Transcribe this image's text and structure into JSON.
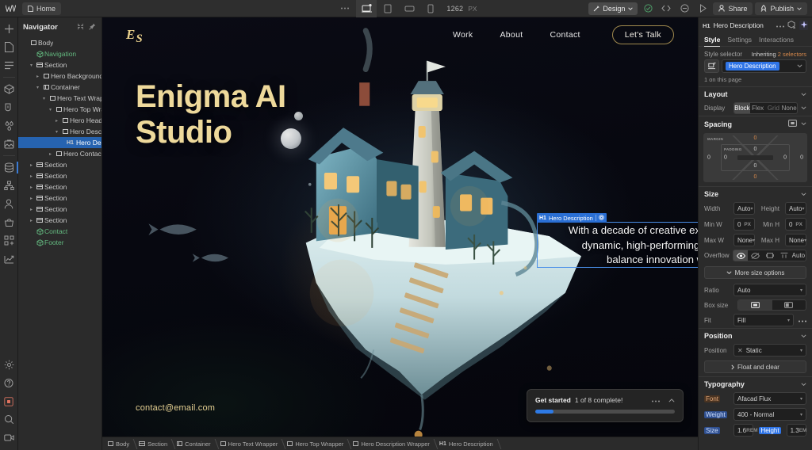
{
  "topbar": {
    "logo": "W",
    "page_label": "Home",
    "breakpoints": [
      "desktop",
      "tablet",
      "mobile-landscape",
      "mobile-portrait"
    ],
    "canvas_width": "1262",
    "canvas_unit": "PX",
    "mode_label": "Design",
    "share_label": "Share",
    "publish_label": "Publish",
    "icons": [
      "more-horizontal-icon",
      "checkmark-circle-icon",
      "code-icon",
      "preview-icon",
      "play-icon",
      "person-icon",
      "rocket-icon"
    ]
  },
  "rail": {
    "items": [
      {
        "name": "add-element",
        "icon": "plus-icon"
      },
      {
        "name": "pages",
        "icon": "page-icon"
      },
      {
        "name": "navigator",
        "icon": "layers-icon"
      },
      {
        "name": "components",
        "icon": "cube-icon"
      },
      {
        "name": "style-manager",
        "icon": "paint-icon"
      },
      {
        "name": "variables",
        "icon": "droplets-icon"
      },
      {
        "name": "assets",
        "icon": "image-icon"
      },
      {
        "name": "cms",
        "icon": "database-icon"
      },
      {
        "name": "logic",
        "icon": "flow-icon"
      },
      {
        "name": "users",
        "icon": "user-icon"
      },
      {
        "name": "ecommerce",
        "icon": "basket-icon"
      },
      {
        "name": "apps",
        "icon": "apps-icon"
      },
      {
        "name": "analyze",
        "icon": "chart-icon"
      }
    ],
    "bottom": [
      {
        "name": "settings",
        "icon": "gear-icon"
      },
      {
        "name": "help",
        "icon": "question-icon"
      },
      {
        "name": "recording",
        "icon": "record-icon"
      },
      {
        "name": "search",
        "icon": "search-icon"
      },
      {
        "name": "video",
        "icon": "video-icon"
      }
    ]
  },
  "navigator": {
    "title": "Navigator",
    "header_icons": [
      "collapse-all-icon",
      "pin-icon"
    ],
    "tree": [
      {
        "label": "Body",
        "indent": 0,
        "twisty": "",
        "icon": "square",
        "kind": "el"
      },
      {
        "label": "Navigation",
        "indent": 1,
        "twisty": "",
        "icon": "component",
        "kind": "component"
      },
      {
        "label": "Section",
        "indent": 1,
        "twisty": "v",
        "icon": "section",
        "kind": "el"
      },
      {
        "label": "Hero Background Wrap",
        "indent": 2,
        "twisty": ">",
        "icon": "square",
        "kind": "el"
      },
      {
        "label": "Container",
        "indent": 2,
        "twisty": "v",
        "icon": "container",
        "kind": "el"
      },
      {
        "label": "Hero Text Wrapper",
        "indent": 3,
        "twisty": "v",
        "icon": "square",
        "kind": "el"
      },
      {
        "label": "Hero Top Wrapper",
        "indent": 4,
        "twisty": "v",
        "icon": "square",
        "kind": "el"
      },
      {
        "label": "Hero Heading W",
        "indent": 5,
        "twisty": ">",
        "icon": "square",
        "kind": "el"
      },
      {
        "label": "Hero Descriptio",
        "indent": 5,
        "twisty": "v",
        "icon": "square",
        "kind": "el"
      },
      {
        "label": "Hero Descrip",
        "indent": 6,
        "twisty": "",
        "icon": "none",
        "kind": "selected",
        "tag": "H1"
      },
      {
        "label": "Hero Contact Info",
        "indent": 4,
        "twisty": ">",
        "icon": "square",
        "kind": "el"
      },
      {
        "label": "Section",
        "indent": 1,
        "twisty": ">",
        "icon": "section",
        "kind": "el"
      },
      {
        "label": "Section",
        "indent": 1,
        "twisty": ">",
        "icon": "section",
        "kind": "el"
      },
      {
        "label": "Section",
        "indent": 1,
        "twisty": ">",
        "icon": "section",
        "kind": "el"
      },
      {
        "label": "Section",
        "indent": 1,
        "twisty": ">",
        "icon": "section",
        "kind": "el"
      },
      {
        "label": "Section",
        "indent": 1,
        "twisty": ">",
        "icon": "section",
        "kind": "el"
      },
      {
        "label": "Section",
        "indent": 1,
        "twisty": ">",
        "icon": "section",
        "kind": "el"
      },
      {
        "label": "Contact",
        "indent": 1,
        "twisty": "",
        "icon": "component",
        "kind": "component"
      },
      {
        "label": "Footer",
        "indent": 1,
        "twisty": "",
        "icon": "component",
        "kind": "component"
      }
    ]
  },
  "canvas": {
    "site": {
      "brand_main": "E",
      "brand_sub": "S",
      "nav_links": [
        "Work",
        "About",
        "Contact"
      ],
      "cta_label": "Let's Talk",
      "heading_line1": "Enigma AI",
      "heading_line2": "Studio",
      "paragraph": "With a decade of creative expertise, I craft dynamic, high-performing websites that balance innovation with elegance.",
      "contact_email": "contact@email.com"
    },
    "selection": {
      "tag": "H1",
      "label": "Hero Description",
      "settings_icon": "gear-icon"
    },
    "get_started": {
      "title": "Get started",
      "subtitle": "1 of 8 complete!",
      "progress_percent": 13,
      "more_icon": "more-horizontal-icon",
      "collapse_icon": "chevron-up-icon"
    },
    "breadcrumbs": [
      {
        "tag": "",
        "label": "Body",
        "icon": "square"
      },
      {
        "tag": "",
        "label": "Section",
        "icon": "section"
      },
      {
        "tag": "",
        "label": "Container",
        "icon": "container"
      },
      {
        "tag": "",
        "label": "Hero Text Wrapper",
        "icon": "square"
      },
      {
        "tag": "",
        "label": "Hero Top Wrapper",
        "icon": "square"
      },
      {
        "tag": "",
        "label": "Hero Description Wrapper",
        "icon": "square"
      },
      {
        "tag": "H1",
        "label": "Hero Description",
        "icon": "none"
      }
    ]
  },
  "style_panel": {
    "element_tag": "H1",
    "element_name": "Hero Description",
    "header_icons": [
      "more-horizontal-icon",
      "add-component-icon",
      "ai-sparkle-icon"
    ],
    "tabs": [
      {
        "label": "Style",
        "active": true
      },
      {
        "label": "Settings",
        "active": false
      },
      {
        "label": "Interactions",
        "active": false
      }
    ],
    "selector": {
      "label": "Style selector",
      "inheriting_prefix": "Inheriting",
      "inheriting_value": "2 selectors",
      "chip": "Hero Description",
      "note": "1 on this page",
      "combo_icon": "selector-icon",
      "chevron": "chevron-down-icon"
    },
    "layout": {
      "title": "Layout",
      "display_label": "Display",
      "options": [
        {
          "label": "Block",
          "state": "on"
        },
        {
          "label": "Flex",
          "state": "off"
        },
        {
          "label": "Grid",
          "state": "dim"
        },
        {
          "label": "None",
          "state": "off"
        }
      ]
    },
    "spacing": {
      "title": "Spacing",
      "margin_label": "MARGIN",
      "padding_label": "PADDING",
      "margin_top": "0",
      "margin_bottom": "0",
      "margin_left": "0",
      "margin_right": "0",
      "padding_top": "0",
      "padding_bottom": "0",
      "padding_left": "0",
      "padding_right": "0"
    },
    "size": {
      "title": "Size",
      "width_label": "Width",
      "width_value": "Auto",
      "height_label": "Height",
      "height_value": "Auto",
      "minw_label": "Min W",
      "minw_value": "0",
      "minw_unit": "PX",
      "minh_label": "Min H",
      "minh_value": "0",
      "minh_unit": "PX",
      "maxw_label": "Max W",
      "maxw_value": "None",
      "maxh_label": "Max H",
      "maxh_value": "None",
      "overflow_label": "Overflow",
      "overflow_auto": "Auto",
      "more_options": "More size options",
      "ratio_label": "Ratio",
      "ratio_value": "Auto",
      "boxsize_label": "Box size",
      "fit_label": "Fit",
      "fit_value": "Fill"
    },
    "position": {
      "title": "Position",
      "label": "Position",
      "value": "Static",
      "float_label": "Float and clear"
    },
    "typography": {
      "title": "Typography",
      "font_label": "Font",
      "font_value": "Afacad Flux",
      "weight_label": "Weight",
      "weight_value": "400 - Normal",
      "size_label": "Size",
      "size_value": "1.6",
      "size_unit": "REM",
      "height_label": "Height",
      "height_value": "1.3",
      "height_unit": "EM"
    }
  },
  "colors": {
    "accent_blue": "#2f74e6",
    "selection_blue": "#4a8fe8",
    "handle_green": "#46d18a",
    "gold": "#eed99b",
    "component_green": "#63b97f",
    "orange": "#d6884b"
  }
}
